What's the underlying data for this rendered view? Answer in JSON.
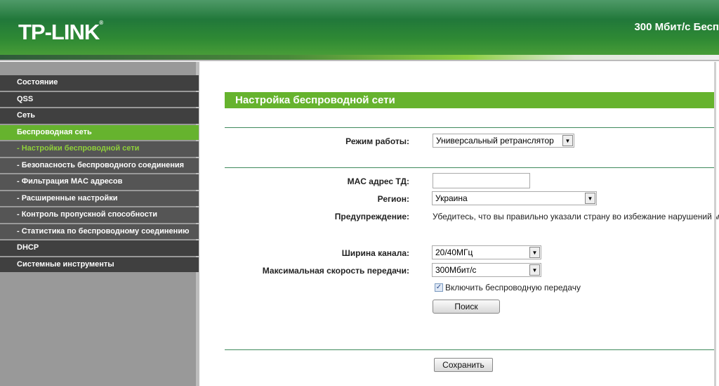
{
  "header": {
    "logo": "TP-LINK",
    "model": "300 Мбит/с Бесп"
  },
  "sidebar": {
    "items": [
      {
        "label": "Состояние",
        "type": "main"
      },
      {
        "label": "QSS",
        "type": "main"
      },
      {
        "label": "Сеть",
        "type": "main"
      },
      {
        "label": "Беспроводная сеть",
        "type": "active"
      },
      {
        "label": "- Настройки беспроводной сети",
        "type": "current"
      },
      {
        "label": "- Безопасность беспроводного соединения",
        "type": "sub"
      },
      {
        "label": "- Фильтрация MAC адресов",
        "type": "sub"
      },
      {
        "label": "- Расширенные настройки",
        "type": "sub"
      },
      {
        "label": "- Контроль пропускной способности",
        "type": "sub"
      },
      {
        "label": "- Статистика по беспроводному соединению",
        "type": "sub"
      },
      {
        "label": "DHCP",
        "type": "main"
      },
      {
        "label": "Системные инструменты",
        "type": "main"
      }
    ]
  },
  "main": {
    "title": "Настройка беспроводной сети",
    "mode_label": "Режим работы:",
    "mode_value": "Универсальный ретранслятор",
    "mac_label": "MAC адрес ТД:",
    "mac_value": "",
    "region_label": "Регион:",
    "region_value": "Украина",
    "warning_label": "Предупреждение:",
    "warning_text": "Убедитесь, что вы правильно указали страну во избежание нарушений м",
    "width_label": "Ширина канала:",
    "width_value": "20/40МГц",
    "rate_label": "Максимальная скорость передачи:",
    "rate_value": "300Мбит/с",
    "enable_label": "Включить беспроводную передачу",
    "enable_checked": true,
    "search_button": "Поиск",
    "save_button": "Сохранить"
  },
  "colors": {
    "accent": "#66b32e",
    "header": "#21783a"
  }
}
